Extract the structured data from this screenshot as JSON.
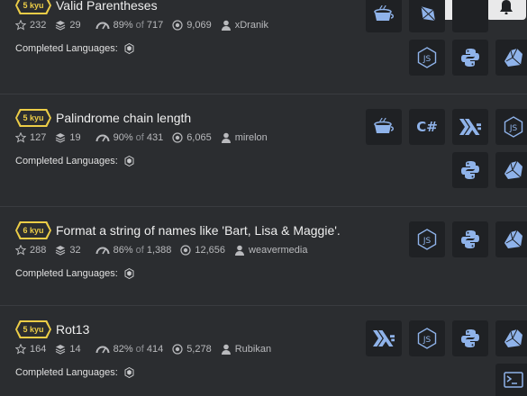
{
  "colors": {
    "background": "#2b2d30",
    "rank_yellow": "#eccd47",
    "icon_blue": "#8fb3ea",
    "button_bg": "#1f2124"
  },
  "top_actions": [
    {
      "icon": "bookmark-icon"
    },
    {
      "icon": "bell-icon"
    }
  ],
  "languages_label": "Completed Languages:",
  "katas": [
    {
      "rank": "5 kyu",
      "title": "Valid Parentheses",
      "stars": "232",
      "collections": "29",
      "satisfaction_pct": "89%",
      "of_label": "of",
      "votes": "717",
      "completed": "9,069",
      "author": "xDranik",
      "languages": [
        "coffeescript",
        "crystal",
        "javascript",
        "python",
        "ruby"
      ]
    },
    {
      "rank": "5 kyu",
      "title": "Palindrome chain length",
      "stars": "127",
      "collections": "19",
      "satisfaction_pct": "90%",
      "of_label": "of",
      "votes": "431",
      "completed": "6,065",
      "author": "mirelon",
      "languages": [
        "coffeescript",
        "csharp",
        "haskell",
        "javascript",
        "python",
        "ruby"
      ]
    },
    {
      "rank": "6 kyu",
      "title": "Format a string of names like 'Bart, Lisa & Maggie'.",
      "stars": "288",
      "collections": "32",
      "satisfaction_pct": "86%",
      "of_label": "of",
      "votes": "1,388",
      "completed": "12,656",
      "author": "weavermedia",
      "languages": [
        "javascript",
        "python",
        "ruby"
      ]
    },
    {
      "rank": "5 kyu",
      "title": "Rot13",
      "stars": "164",
      "collections": "14",
      "satisfaction_pct": "82%",
      "of_label": "of",
      "votes": "414",
      "completed": "5,278",
      "author": "Rubikan",
      "languages": [
        "haskell",
        "javascript",
        "python",
        "ruby",
        "shell"
      ]
    }
  ],
  "csharp_label": "C#"
}
